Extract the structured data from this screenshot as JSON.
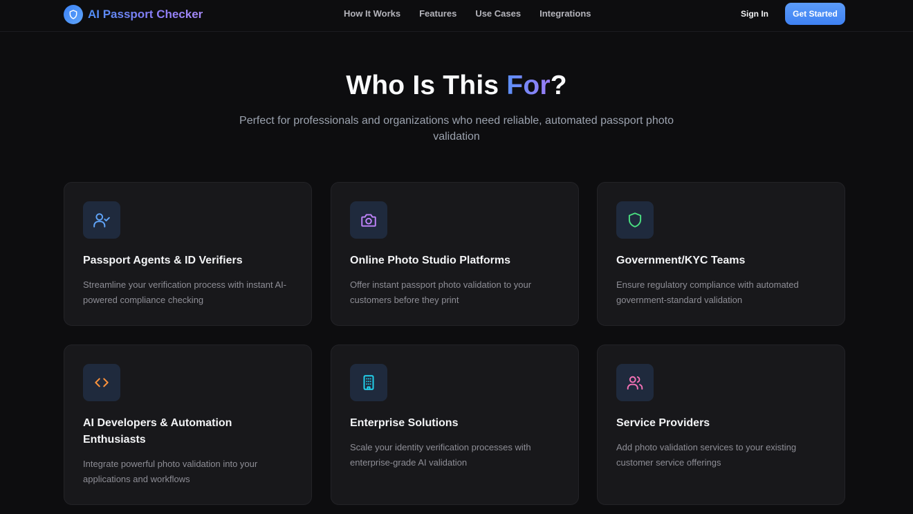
{
  "brand": {
    "name": "AI Passport Checker",
    "icon": "shield-icon"
  },
  "nav": {
    "links": [
      "How It Works",
      "Features",
      "Use Cases",
      "Integrations"
    ],
    "sign_in": "Sign In",
    "get_started": "Get Started"
  },
  "hero": {
    "title_prefix": "Who Is This ",
    "title_accent": "For",
    "title_suffix": "?",
    "subtitle": "Perfect for professionals and organizations who need reliable, automated passport photo validation"
  },
  "cards": [
    {
      "icon": "user-check-icon",
      "icon_color": "#60a5fa",
      "title": "Passport Agents & ID Verifiers",
      "description": "Streamline your verification process with instant AI-powered compliance checking"
    },
    {
      "icon": "camera-icon",
      "icon_color": "#c084fc",
      "title": "Online Photo Studio Platforms",
      "description": "Offer instant passport photo validation to your customers before they print"
    },
    {
      "icon": "shield-icon",
      "icon_color": "#4ade80",
      "title": "Government/KYC Teams",
      "description": "Ensure regulatory compliance with automated government-standard validation"
    },
    {
      "icon": "code-icon",
      "icon_color": "#fb923c",
      "title": "AI Developers & Automation Enthusiasts",
      "description": "Integrate powerful photo validation into your applications and workflows"
    },
    {
      "icon": "building-icon",
      "icon_color": "#22d3ee",
      "title": "Enterprise Solutions",
      "description": "Scale your identity verification processes with enterprise-grade AI validation"
    },
    {
      "icon": "users-icon",
      "icon_color": "#f472b6",
      "title": "Service Providers",
      "description": "Add photo validation services to your existing customer service offerings"
    }
  ]
}
